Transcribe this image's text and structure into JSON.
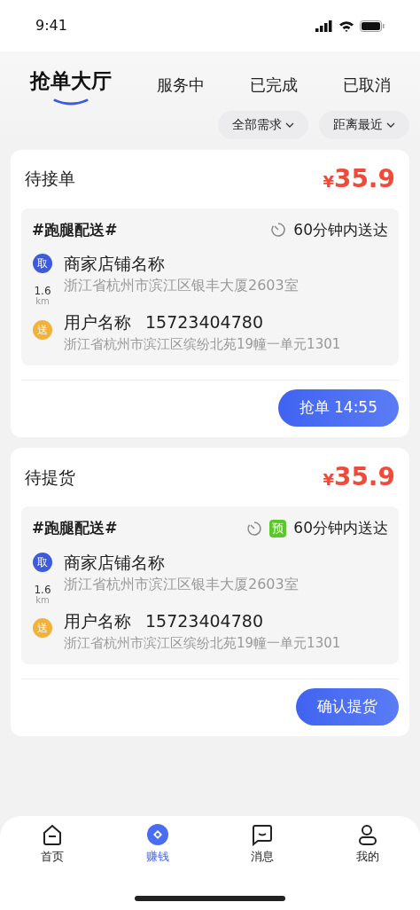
{
  "status_bar": {
    "time": "9:41"
  },
  "tabs": [
    {
      "label": "抢单大厅",
      "selected": true
    },
    {
      "label": "服务中",
      "selected": false
    },
    {
      "label": "已完成",
      "selected": false
    },
    {
      "label": "已取消",
      "selected": false
    }
  ],
  "filters": [
    "全部需求",
    "距离最近"
  ],
  "orders": [
    {
      "status": "待接单",
      "currency": "¥",
      "amount": "35.9",
      "tag": "#跑腿配送#",
      "deadline": "60分钟内送达",
      "pickup_icon": "取",
      "pickup_name": "商家店铺名称",
      "pickup_address": "浙江省杭州市滨江区银丰大厦2603室",
      "distance": "1.6",
      "distance_unit": "km",
      "dropoff_icon": "送",
      "dropoff_name": "用户名称",
      "dropoff_phone": "15723404780",
      "dropoff_address": "浙江省杭州市滨江区缤纷北苑19幢一单元1301",
      "action": "抢单 14:55"
    },
    {
      "status": "待提货",
      "currency": "¥",
      "amount": "35.9",
      "tag": "#跑腿配送#",
      "badge": "预",
      "deadline": "60分钟内送达",
      "pickup_icon": "取",
      "pickup_name": "商家店铺名称",
      "pickup_address": "浙江省杭州市滨江区银丰大厦2603室",
      "distance": "1.6",
      "distance_unit": "km",
      "dropoff_icon": "送",
      "dropoff_name": "用户名称",
      "dropoff_phone": "15723404780",
      "dropoff_address": "浙江省杭州市滨江区缤纷北苑19幢一单元1301",
      "action": "确认提货"
    }
  ],
  "nav": [
    {
      "label": "首页",
      "kind": "home",
      "selected": false
    },
    {
      "label": "赚钱",
      "kind": "earn",
      "selected": true
    },
    {
      "label": "消息",
      "kind": "message",
      "selected": false
    },
    {
      "label": "我的",
      "kind": "profile",
      "selected": false
    }
  ]
}
